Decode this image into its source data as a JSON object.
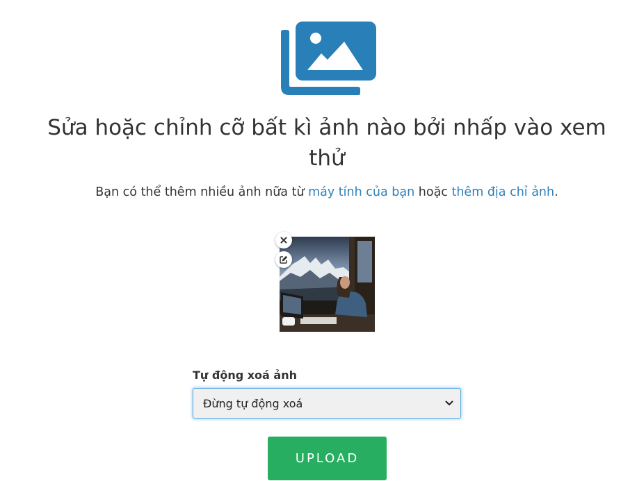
{
  "hero": {
    "icon": "image-gallery-icon",
    "accent_color": "#2980b9"
  },
  "heading": {
    "title": "Sửa hoặc chỉnh cỡ bất kì ảnh nào bởi nhấp vào xem thử"
  },
  "intro": {
    "text_before": "Bạn có thể thêm nhiều ảnh nữa từ ",
    "link_computer": "máy tính của bạn",
    "text_middle": " hoặc ",
    "link_url": "thêm địa chỉ ảnh",
    "text_after": ".",
    "link_color": "#2f80b8"
  },
  "thumbnail": {
    "remove_icon": "close-icon",
    "edit_icon": "edit-icon"
  },
  "auto_delete": {
    "label": "Tự động xoá ảnh",
    "selected": "Đừng tự động xoá"
  },
  "upload": {
    "label": "UPLOAD",
    "color": "#27ae60"
  }
}
